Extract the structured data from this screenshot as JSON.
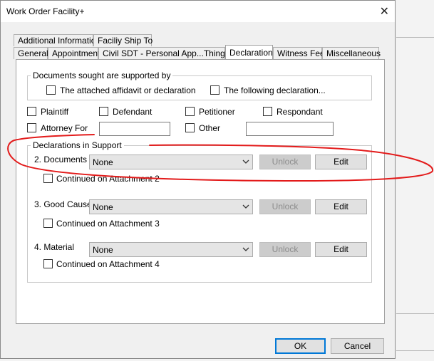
{
  "window": {
    "title": "Work Order Facility+",
    "close_glyph": "✕"
  },
  "tabs_row1": [
    {
      "label": "Additional Information"
    },
    {
      "label": "Faciliy Ship To"
    }
  ],
  "tabs_row2": [
    {
      "label": "General"
    },
    {
      "label": "Appointment"
    },
    {
      "label": "Civil SDT - Personal App...Things..."
    },
    {
      "label": "Declaration",
      "active": true
    },
    {
      "label": "Witness Fee"
    },
    {
      "label": "Miscellaneous"
    }
  ],
  "documents_group": {
    "legend": "Documents sought are supported by",
    "options": [
      {
        "label": "The attached affidavit or declaration",
        "checked": false
      },
      {
        "label": "The following declaration...",
        "checked": false
      }
    ]
  },
  "parties": {
    "plaintiff": "Plaintiff",
    "defendant": "Defendant",
    "petitioner": "Petitioner",
    "respondant": "Respondant",
    "attorney_for": "Attorney For",
    "attorney_for_value": "",
    "other": "Other",
    "other_value": ""
  },
  "declarations": {
    "legend": "Declarations in Support",
    "rows": [
      {
        "label": "2. Documents",
        "value": "None",
        "unlock": "Unlock",
        "edit": "Edit",
        "continued": "Continued on Attachment 2"
      },
      {
        "label": "3. Good Cause",
        "value": "None",
        "unlock": "Unlock",
        "edit": "Edit",
        "continued": "Continued on Attachment 3"
      },
      {
        "label": "4. Material",
        "value": "None",
        "unlock": "Unlock",
        "edit": "Edit",
        "continued": "Continued on Attachment 4"
      }
    ]
  },
  "footer": {
    "ok": "OK",
    "cancel": "Cancel"
  },
  "colors": {
    "annotation": "#e31b1b",
    "default_button_border": "#0078d7"
  }
}
